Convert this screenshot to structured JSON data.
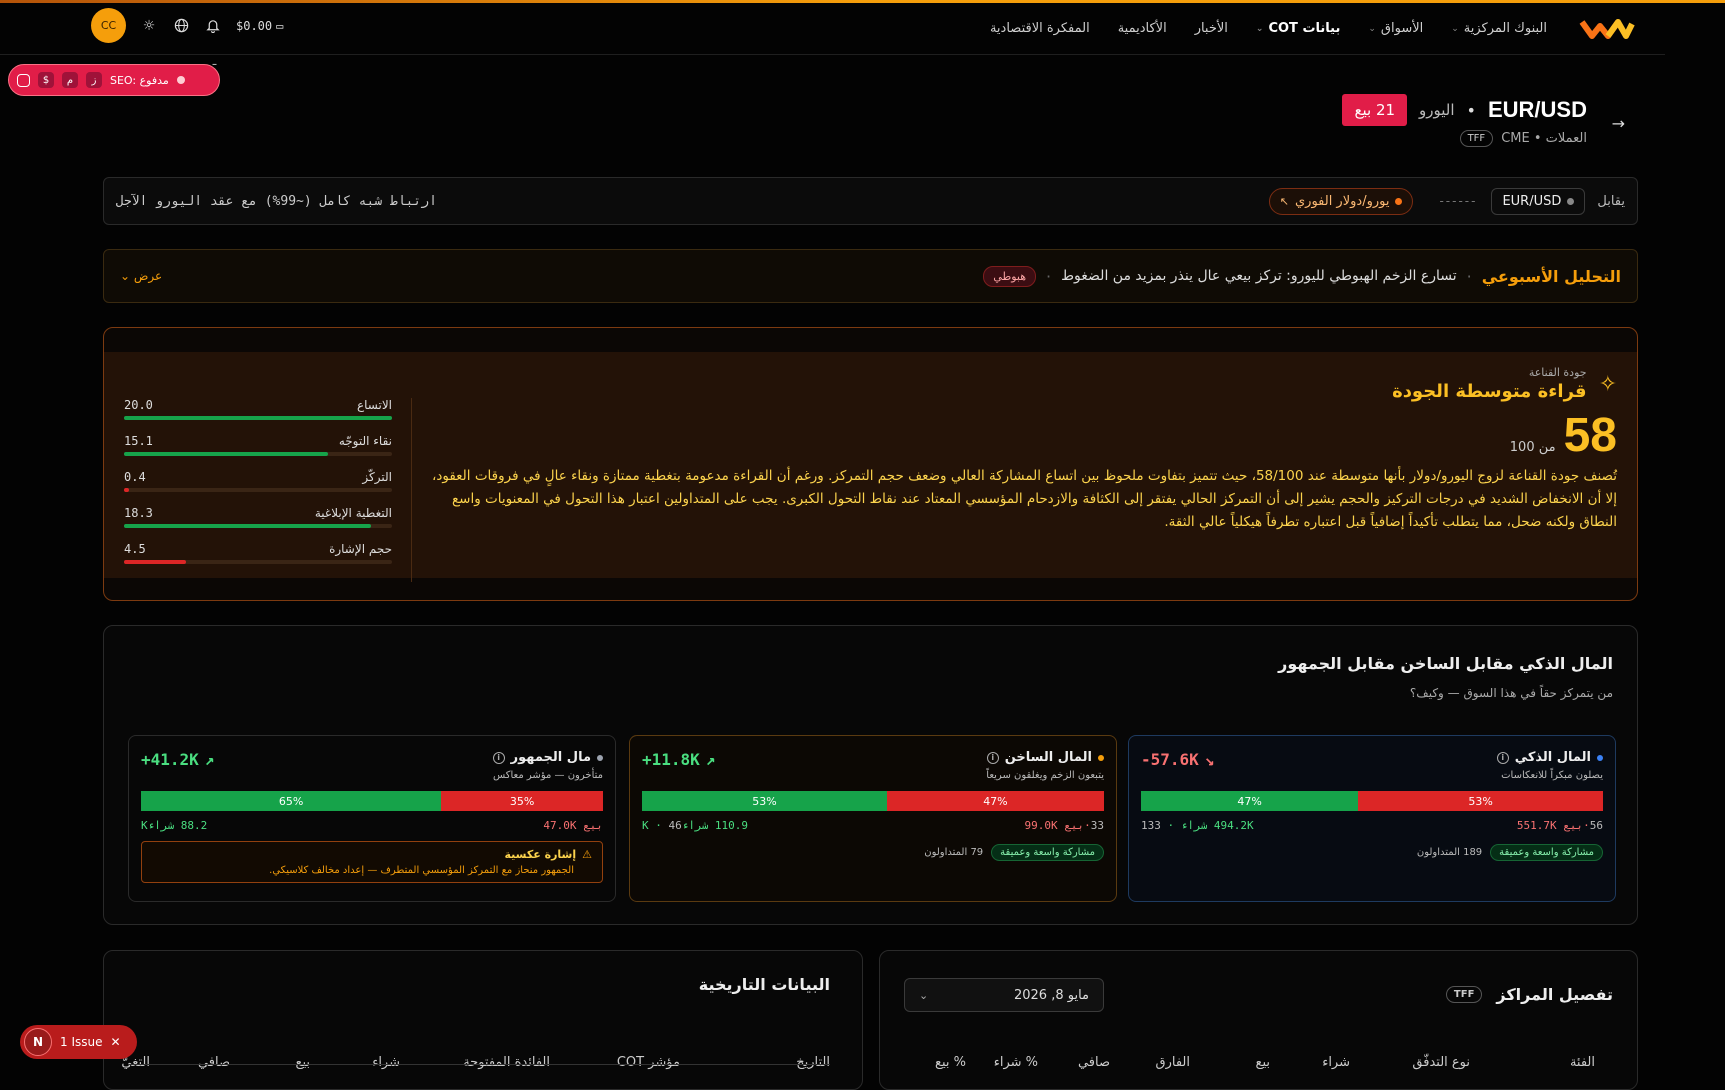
{
  "header": {
    "nav": [
      {
        "label": "البنوك المركزية",
        "dropdown": true,
        "active": false
      },
      {
        "label": "الأسواق",
        "dropdown": true,
        "active": false
      },
      {
        "label": "بيانات COT",
        "dropdown": true,
        "active": true
      },
      {
        "label": "الأخبار",
        "dropdown": false,
        "active": false
      },
      {
        "label": "الأكاديمية",
        "dropdown": false,
        "active": false
      },
      {
        "label": "المفكرة الاقتصادية",
        "dropdown": false,
        "active": false
      }
    ],
    "avatar": "CC",
    "balance": "$0.00",
    "accent": "#f59e0b"
  },
  "seo_toolbar": {
    "label": "SEO: مدفوع",
    "buttons": [
      "ز",
      "م",
      "$"
    ]
  },
  "instrument": {
    "symbol": "EUR/USD",
    "name": "اليورو",
    "badge": "21 بيع",
    "meta": "العملات • CME",
    "report": "TFF"
  },
  "correlation": {
    "vs_label": "يقابل",
    "spot": "EUR/USD",
    "dashes": "------",
    "future": "يورو/دولار الفوري",
    "note": "ارتباط شبه كامل (~99%) مع عقد اليورو الآجل"
  },
  "weekly": {
    "title": "التحليل الأسبوعي",
    "text": "تسارع الزخم الهبوطي لليورو: تركز بيعي عال ينذر بمزيد من الضغوط",
    "badge": "هبوطي",
    "toggle": "عرض"
  },
  "quality": {
    "label": "جودة القناعة",
    "title": "قراءة متوسطة الجودة",
    "score": "58",
    "out_of": "من 100",
    "description": "تُصنف جودة القناعة لزوج اليورو/دولار بأنها متوسطة عند 58/100، حيث تتميز بتفاوت ملحوظ بين اتساع المشاركة العالي وضعف حجم التمركز. ورغم أن القراءة مدعومة بتغطية ممتازة ونقاء عالٍ في فروقات العقود، إلا أن الانخفاض الشديد في درجات التركيز والحجم يشير إلى أن التمركز الحالي يفتقر إلى الكثافة والازدحام المؤسسي المعتاد عند نقاط التحول الكبرى. يجب على المتداولين اعتبار هذا التحول في المعنويات واسع النطاق ولكنه ضحل، مما يتطلب تأكيداً إضافياً قبل اعتباره تطرفاً هيكلياً عالي الثقة.",
    "metrics": [
      {
        "label": "الاتساع",
        "value": "20.0",
        "fill": 1.0,
        "color": "#16a34a"
      },
      {
        "label": "نقاء التوجّه",
        "value": "15.1",
        "fill": 0.76,
        "color": "#16a34a"
      },
      {
        "label": "التركّز",
        "value": "0.4",
        "fill": 0.02,
        "color": "#dc2626"
      },
      {
        "label": "التغطية الإبلاغية",
        "value": "18.3",
        "fill": 0.92,
        "color": "#16a34a"
      },
      {
        "label": "حجم الإشارة",
        "value": "4.5",
        "fill": 0.23,
        "color": "#dc2626"
      }
    ]
  },
  "smart_money": {
    "title": "المال الذكي مقابل الساخن مقابل الجمهور",
    "subtitle": "من يتمركز حقاً في هذا السوق — وكيف؟",
    "cards": [
      {
        "name": "المال الذكي",
        "dot": "#3b82f6",
        "sub": "يصلون مبكراً للانعكاسات",
        "net": "-57.6K",
        "net_color": "#f87171",
        "arrow": "↘",
        "buy_pct": 47,
        "sell_pct": 53,
        "buy_label": "47%",
        "sell_label": "53%",
        "sell_text": "بيع 551.7K",
        "sell_count": "56",
        "buy_text": "494.2K شراء",
        "buy_count": "133",
        "pill": "مشاركة واسعة وعميقة",
        "traders": "189 المتداولون",
        "border": "#1e3a5f",
        "bg": "#070b12"
      },
      {
        "name": "المال الساخن",
        "dot": "#f59e0b",
        "sub": "يتبعون الزخم ويغلقون سريعاً",
        "net": "+11.8K",
        "net_color": "#4ade80",
        "arrow": "↗",
        "buy_pct": 53,
        "sell_pct": 47,
        "buy_label": "53%",
        "sell_label": "47%",
        "sell_text": "بيع 99.0K",
        "sell_count": "33",
        "buy_text": "110.9 شراءK",
        "buy_count": "46",
        "pill": "مشاركة واسعة وعميقة",
        "traders": "79 المتداولون",
        "border": "#5a3a10",
        "bg": "#0c0804"
      },
      {
        "name": "مال الجمهور",
        "dot": "#9ca3af",
        "sub": "متأخرون — مؤشر معاكس",
        "net": "+41.2K",
        "net_color": "#4ade80",
        "arrow": "↗",
        "buy_pct": 65,
        "sell_pct": 35,
        "buy_label": "65%",
        "sell_label": "35%",
        "sell_text": "بيع 47.0K",
        "sell_count": "",
        "buy_text": "88.2 شراءK",
        "buy_count": "",
        "warn_title": "إشارة عكسية",
        "warn_text": "الجمهور منحاز مع التمركز المؤسسي المتطرف — إعداد مخالف كلاسيكي.",
        "border": "#2a2a2a",
        "bg": "#070707"
      }
    ]
  },
  "positions": {
    "title": "تفصيل المراكز",
    "report": "TFF",
    "date": "مايو 8, 2026",
    "columns": [
      "الفئة",
      "نوع التدفّق",
      "شراء",
      "بيع",
      "الفارق",
      "صافي",
      "% شراء",
      "% بيع"
    ]
  },
  "history": {
    "title": "البيانات التاريخية",
    "columns": [
      "التاريخ",
      "مؤشر COT",
      "الفائدة المفتوحة",
      "شراء",
      "بيع",
      "صافي",
      "التغيّ"
    ]
  },
  "issues": {
    "badge": "N",
    "label": "1 Issue"
  }
}
